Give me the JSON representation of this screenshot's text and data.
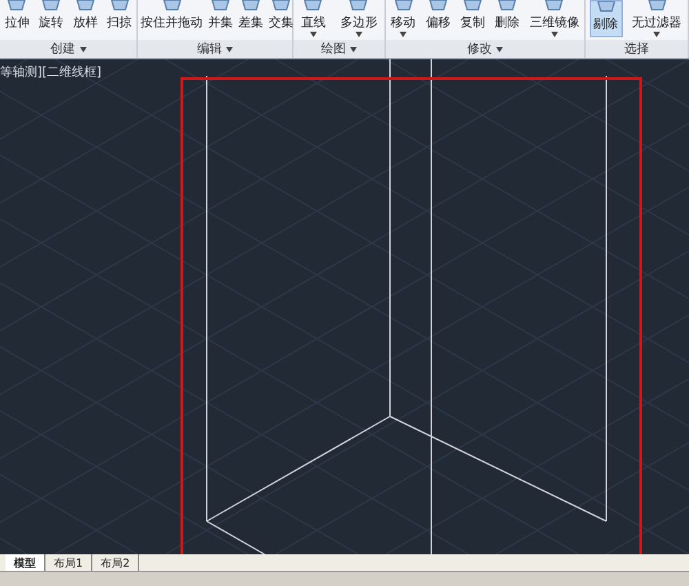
{
  "ribbon": {
    "panels": [
      {
        "title": "创建",
        "has_menu": true,
        "buttons": [
          {
            "label": "拉伸",
            "selected": false,
            "has_menu": false
          },
          {
            "label": "旋转",
            "selected": false,
            "has_menu": false
          },
          {
            "label": "放样",
            "selected": false,
            "has_menu": false
          },
          {
            "label": "扫掠",
            "selected": false,
            "has_menu": false
          }
        ]
      },
      {
        "title": "编辑",
        "has_menu": true,
        "buttons": [
          {
            "label": "按住并拖动",
            "selected": false,
            "has_menu": false
          },
          {
            "label": "并集",
            "selected": false,
            "has_menu": false
          },
          {
            "label": "差集",
            "selected": false,
            "has_menu": false
          },
          {
            "label": "交集",
            "selected": false,
            "has_menu": false
          }
        ]
      },
      {
        "title": "绘图",
        "has_menu": true,
        "buttons": [
          {
            "label": "直线",
            "selected": false,
            "has_menu": true
          },
          {
            "label": "多边形",
            "selected": false,
            "has_menu": true
          }
        ]
      },
      {
        "title": "修改",
        "has_menu": true,
        "buttons": [
          {
            "label": "移动",
            "selected": false,
            "has_menu": true
          },
          {
            "label": "偏移",
            "selected": false,
            "has_menu": false
          },
          {
            "label": "复制",
            "selected": false,
            "has_menu": false
          },
          {
            "label": "删除",
            "selected": false,
            "has_menu": false
          },
          {
            "label": "三维镜像",
            "selected": false,
            "has_menu": true
          }
        ]
      },
      {
        "title": "选择",
        "has_menu": false,
        "buttons": [
          {
            "label": "剔除",
            "selected": true,
            "has_menu": false
          },
          {
            "label": "无过滤器",
            "selected": false,
            "has_menu": true
          }
        ]
      }
    ]
  },
  "viewport": {
    "label": "等轴测][二维线框]"
  },
  "layout_tabs": [
    {
      "label": "模型",
      "selected": true
    },
    {
      "label": "布局1",
      "selected": false
    },
    {
      "label": "布局2",
      "selected": false
    }
  ]
}
